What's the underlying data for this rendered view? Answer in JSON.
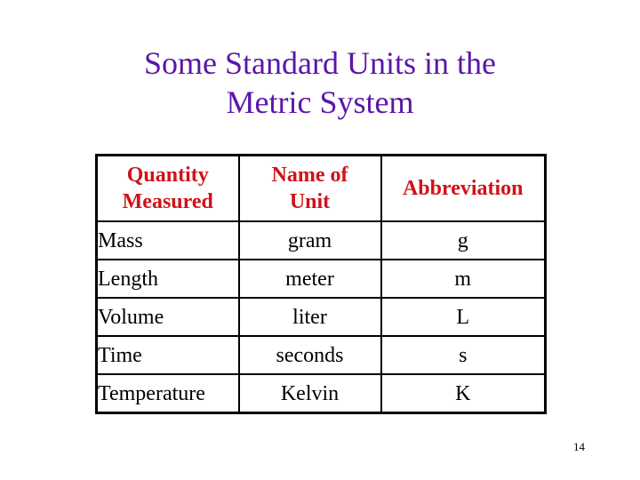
{
  "slide": {
    "title_line1": "Some Standard Units in the",
    "title_line2": "Metric System",
    "page_number": "14",
    "title_color": "#5a16a8",
    "header_color": "#d0121a"
  },
  "table": {
    "headers": [
      {
        "line1": "Quantity",
        "line2": "Measured"
      },
      {
        "line1": "Name of",
        "line2": "Unit"
      },
      {
        "line1": "Abbreviation",
        "line2": ""
      }
    ],
    "rows": [
      {
        "quantity": "Mass",
        "unit": "gram",
        "abbr": "g"
      },
      {
        "quantity": "Length",
        "unit": "meter",
        "abbr": "m"
      },
      {
        "quantity": "Volume",
        "unit": "liter",
        "abbr": "L"
      },
      {
        "quantity": "Time",
        "unit": "seconds",
        "abbr": "s"
      },
      {
        "quantity": "Temperature",
        "unit": "Kelvin",
        "abbr": "K"
      }
    ]
  }
}
